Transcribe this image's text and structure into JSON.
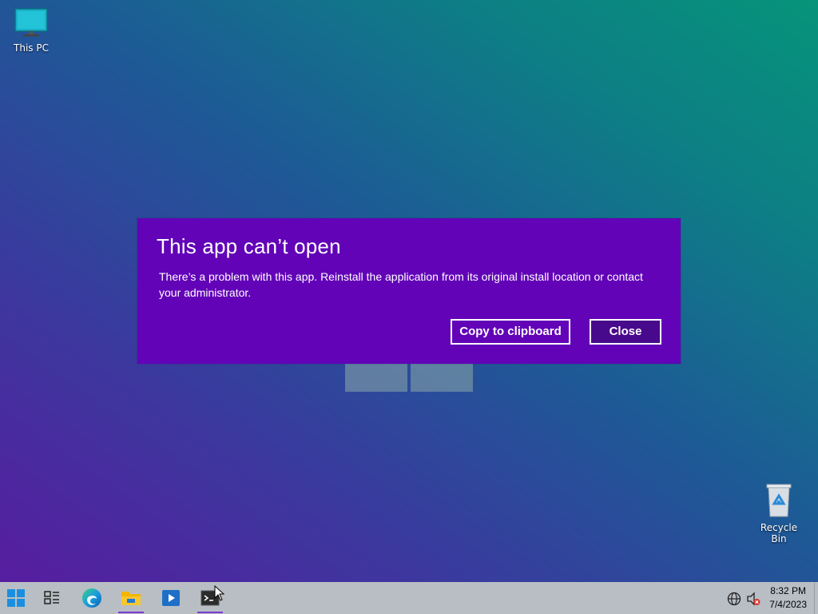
{
  "desktop": {
    "icons": [
      {
        "label": "This PC"
      },
      {
        "label": "Recycle Bin"
      }
    ]
  },
  "dialog": {
    "title": "This app can’t open",
    "message": "There’s a problem with this app. Reinstall the application from its original install location or contact your administrator.",
    "buttons": {
      "copy": "Copy to clipboard",
      "close": "Close"
    },
    "background_color": "#6203b8"
  },
  "taskbar": {
    "items": [
      "start-icon",
      "task-view-icon",
      "edge-icon",
      "file-explorer-icon",
      "media-player-icon",
      "terminal-icon"
    ],
    "clock": {
      "time": "8:32 PM",
      "date": "7/4/2023"
    }
  }
}
